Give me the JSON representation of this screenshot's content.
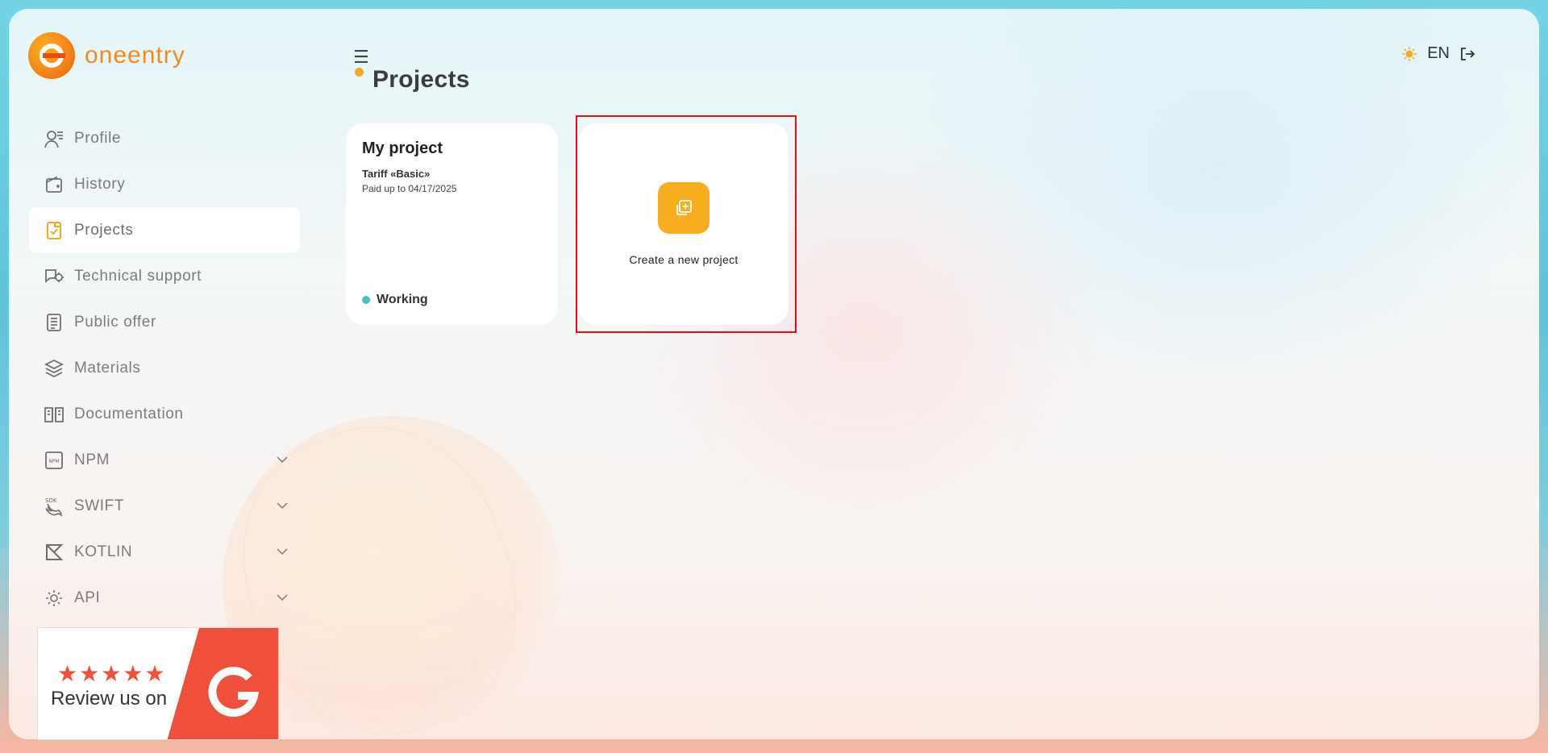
{
  "brand": {
    "name": "oneentry",
    "accent": "#f6a81f"
  },
  "sidebar": {
    "items": [
      {
        "label": "Profile",
        "icon": "profile-icon",
        "active": false,
        "expandable": false
      },
      {
        "label": "History",
        "icon": "wallet-icon",
        "active": false,
        "expandable": false
      },
      {
        "label": "Projects",
        "icon": "projects-icon",
        "active": true,
        "expandable": false
      },
      {
        "label": "Technical support",
        "icon": "support-icon",
        "active": false,
        "expandable": false
      },
      {
        "label": "Public offer",
        "icon": "document-icon",
        "active": false,
        "expandable": false
      },
      {
        "label": "Materials",
        "icon": "layers-icon",
        "active": false,
        "expandable": false
      },
      {
        "label": "Documentation",
        "icon": "book-icon",
        "active": false,
        "expandable": false
      },
      {
        "label": "NPM",
        "icon": "npm-icon",
        "active": false,
        "expandable": true
      },
      {
        "label": "SWIFT",
        "icon": "swift-icon",
        "active": false,
        "expandable": true
      },
      {
        "label": "KOTLIN",
        "icon": "kotlin-icon",
        "active": false,
        "expandable": true
      },
      {
        "label": "API",
        "icon": "api-icon",
        "active": false,
        "expandable": true
      }
    ],
    "review_banner": {
      "text": "Review us on",
      "stars": "★★★★★"
    }
  },
  "header": {
    "page_title": "Projects",
    "language": "EN"
  },
  "projects": [
    {
      "name": "My project",
      "tariff": "Tariff «Basic»",
      "paid": "Paid up to 04/17/2025",
      "status": "Working",
      "status_color": "#45c2c6"
    }
  ],
  "new_project": {
    "label": "Create a new project",
    "highlight_color": "#e0101a"
  }
}
